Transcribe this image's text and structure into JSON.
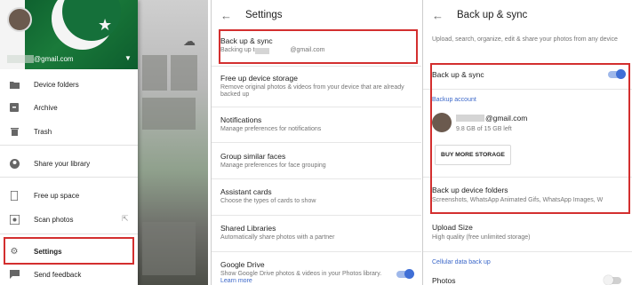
{
  "drawer": {
    "email_suffix": "@gmail.com",
    "items": [
      {
        "label": "Device folders"
      },
      {
        "label": "Archive"
      },
      {
        "label": "Trash"
      },
      {
        "label": "Share your library"
      },
      {
        "label": "Free up space"
      },
      {
        "label": "Scan photos"
      },
      {
        "label": "Settings"
      },
      {
        "label": "Send feedback"
      }
    ]
  },
  "settings": {
    "title": "Settings",
    "items": [
      {
        "title": "Back up & sync",
        "desc": "Backing up to",
        "desc_suffix": "@gmail.com"
      },
      {
        "title": "Free up device storage",
        "desc": "Remove original photos & videos from your device that are already backed up"
      },
      {
        "title": "Notifications",
        "desc": "Manage preferences for notifications"
      },
      {
        "title": "Group similar faces",
        "desc": "Manage preferences for face grouping"
      },
      {
        "title": "Assistant cards",
        "desc": "Choose the types of cards to show"
      },
      {
        "title": "Shared Libraries",
        "desc": "Automatically share photos with a partner"
      },
      {
        "title": "Google Drive",
        "desc": "Show Google Drive photos & videos in your Photos library.",
        "link": "Learn more",
        "toggle": "on"
      }
    ]
  },
  "backup": {
    "title": "Back up & sync",
    "intro": "Upload, search, organize, edit & share your photos from any device",
    "toggle_label": "Back up & sync",
    "toggle_state": "on",
    "account_header": "Backup account",
    "account_email_suffix": "@gmail.com",
    "account_quota": "9.8 GB of 15 GB left",
    "buy_storage": "BUY MORE STORAGE",
    "folders_title": "Back up device folders",
    "folders_sub": "Screenshots, WhatsApp Animated Gifs, WhatsApp Images, W",
    "upload_size_title": "Upload Size",
    "upload_size_sub": "High quality (free unlimited storage)",
    "cellular_header": "Cellular data back up",
    "photos_label": "Photos",
    "photos_toggle": "off"
  },
  "colors": {
    "highlight": "#d32f2f",
    "accent_blue": "#3f6fd6"
  }
}
